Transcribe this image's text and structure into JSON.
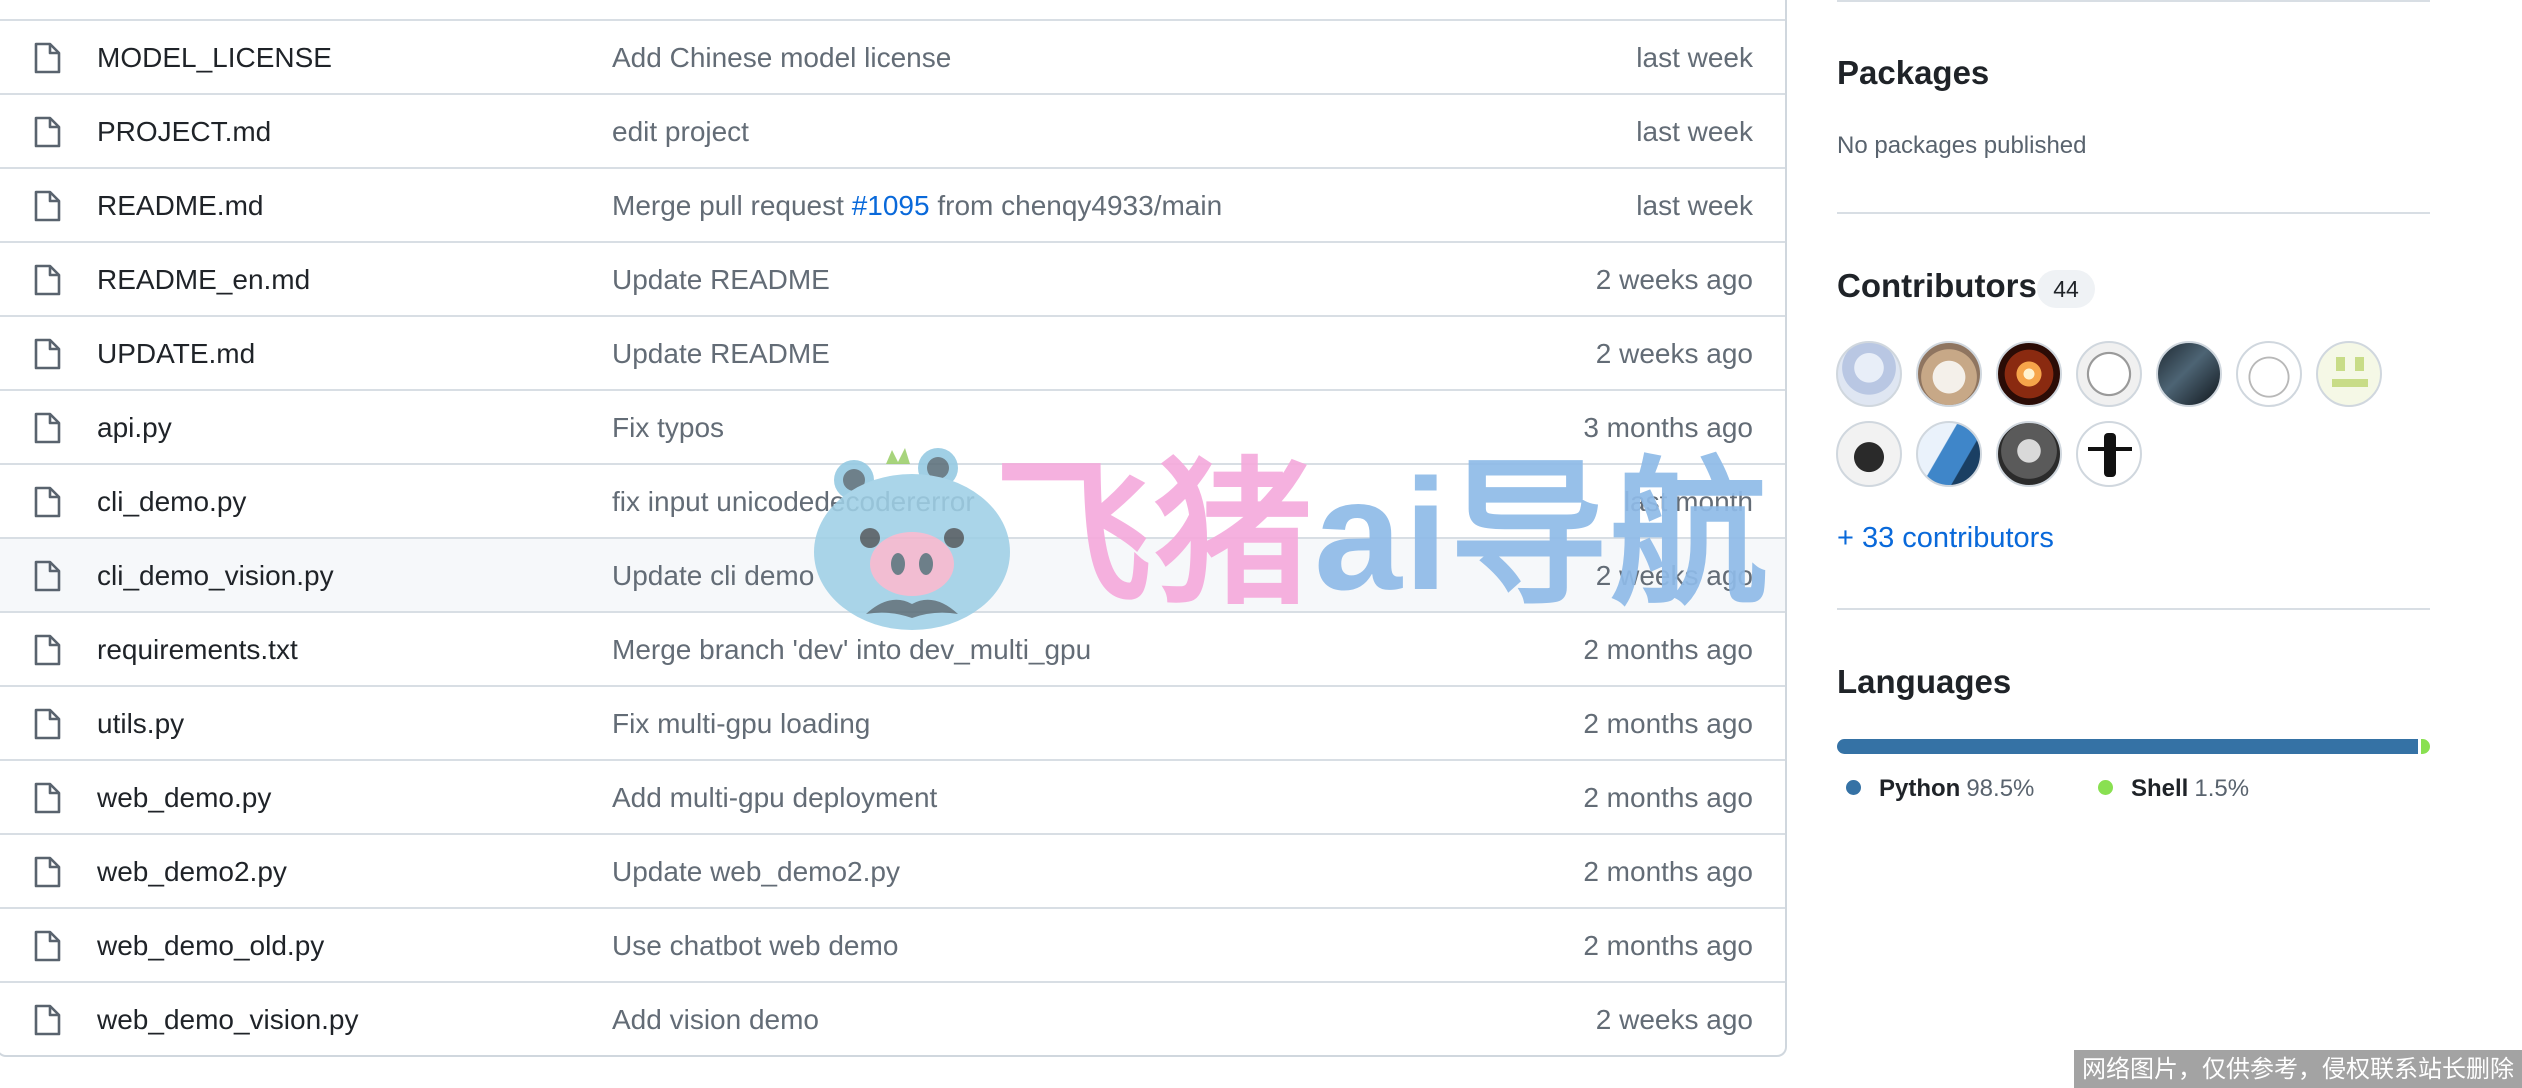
{
  "files": [
    {
      "name": "MODEL_LICENSE",
      "message": "Add Chinese model license",
      "age": "last week"
    },
    {
      "name": "PROJECT.md",
      "message": "edit project",
      "age": "last week"
    },
    {
      "name": "README.md",
      "message_prefix": "Merge pull request ",
      "pr": "#1095",
      "message_suffix": " from chenqy4933/main",
      "age": "last week"
    },
    {
      "name": "README_en.md",
      "message": "Update README",
      "age": "2 weeks ago"
    },
    {
      "name": "UPDATE.md",
      "message": "Update README",
      "age": "2 weeks ago"
    },
    {
      "name": "api.py",
      "message": "Fix typos",
      "age": "3 months ago"
    },
    {
      "name": "cli_demo.py",
      "message": "fix input unicodedecodererror",
      "age": "last month"
    },
    {
      "name": "cli_demo_vision.py",
      "message": "Update cli demo",
      "age": "2 weeks ago"
    },
    {
      "name": "requirements.txt",
      "message": "Merge branch 'dev' into dev_multi_gpu",
      "age": "2 months ago"
    },
    {
      "name": "utils.py",
      "message": "Fix multi-gpu loading",
      "age": "2 months ago"
    },
    {
      "name": "web_demo.py",
      "message": "Add multi-gpu deployment",
      "age": "2 months ago"
    },
    {
      "name": "web_demo2.py",
      "message": "Update web_demo2.py",
      "age": "2 months ago"
    },
    {
      "name": "web_demo_old.py",
      "message": "Use chatbot web demo",
      "age": "2 months ago"
    },
    {
      "name": "web_demo_vision.py",
      "message": "Add vision demo",
      "age": "2 weeks ago"
    }
  ],
  "sidebar": {
    "packages": {
      "title": "Packages",
      "empty": "No packages published"
    },
    "contributors": {
      "title": "Contributors",
      "count": "44",
      "more": "+ 33 contributors",
      "avatars": [
        "avatar-1",
        "avatar-2",
        "avatar-3",
        "avatar-4",
        "avatar-5",
        "avatar-6",
        "avatar-7",
        "avatar-8",
        "avatar-9",
        "avatar-10",
        "avatar-11"
      ]
    },
    "languages": {
      "title": "Languages",
      "items": [
        {
          "name": "Python",
          "percent": "98.5%",
          "value": 98.5,
          "color": "#3572A5"
        },
        {
          "name": "Shell",
          "percent": "1.5%",
          "value": 1.5,
          "color": "#89e051"
        }
      ]
    }
  },
  "watermarks": {
    "brand_part1": "飞猪",
    "brand_part2": "ai导航",
    "brand_colors": {
      "pink": "#f5a9dc",
      "blue": "#8fbbe8"
    },
    "notice": "网络图片，仅供参考，侵权联系站长删除"
  },
  "icons": {
    "file": "file-icon",
    "logo": "pig-logo-icon"
  }
}
